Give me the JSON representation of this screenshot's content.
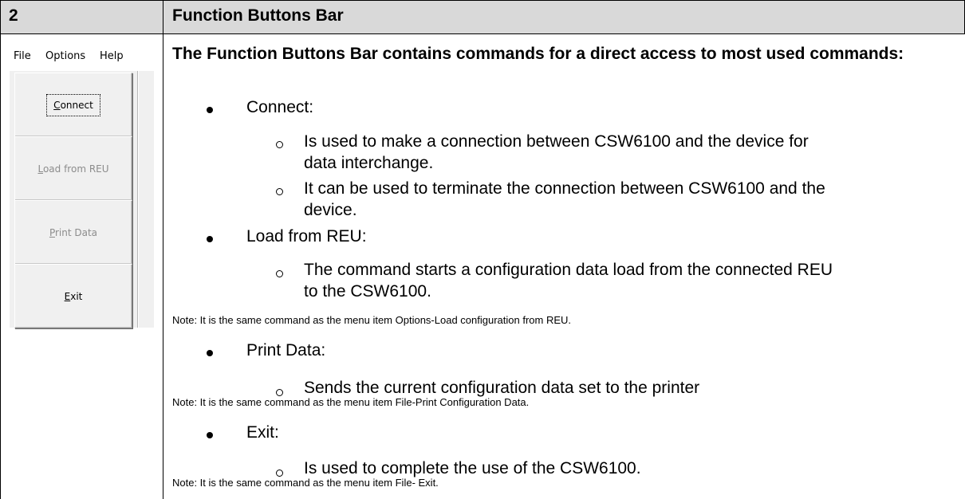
{
  "header": {
    "number": "2",
    "title": "Function Buttons Bar"
  },
  "screenshot": {
    "menu": [
      "File",
      "Options",
      "Help"
    ],
    "buttons": [
      {
        "pre": "",
        "ul": "C",
        "post": "onnect",
        "state": "focused"
      },
      {
        "pre": "",
        "ul": "L",
        "post": "oad from REU",
        "state": "disabled"
      },
      {
        "pre": "",
        "ul": "P",
        "post": "rint Data",
        "state": "disabled"
      },
      {
        "pre": "",
        "ul": "E",
        "post": "xit",
        "state": "normal"
      }
    ]
  },
  "content": {
    "intro": "The Function Buttons Bar contains commands for a direct access to most used commands:",
    "connect": {
      "label": "Connect:",
      "sub1_line1": "Is used to make a connection between CSW6100 and the device for",
      "sub1_line2": "data interchange.",
      "sub2_line1": "It can be used to terminate the connection between CSW6100 and the",
      "sub2_line2": "device."
    },
    "load": {
      "label": "Load from REU:",
      "sub1_line1": "The command starts a configuration data load from the connected REU",
      "sub1_line2": "to the CSW6100.",
      "note": "Note: It is the same command as the menu item Options-Load configuration from REU."
    },
    "print": {
      "label": "Print Data:",
      "sub1_line1": "Sends the current configuration data set to the printer",
      "note": "Note: It is the same command as the menu item File-Print Configuration Data."
    },
    "exit": {
      "label": "Exit:",
      "sub1_line1": "Is used to complete the use of the CSW6100.",
      "note": "Note: It is the same command as the menu item File- Exit."
    }
  }
}
